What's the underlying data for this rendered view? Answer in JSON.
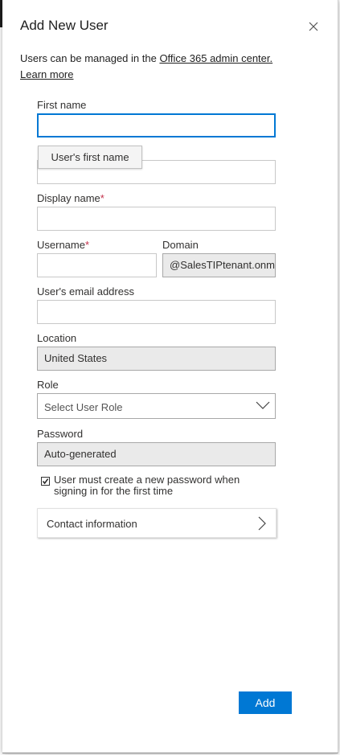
{
  "panel": {
    "title": "Add New User",
    "intro_text": "Users can be managed in the ",
    "admin_link": "Office 365 admin center.",
    "learn_more": "Learn more"
  },
  "form": {
    "first_name_label": "First name",
    "first_name_value": "",
    "first_name_tooltip": "User's first name",
    "last_name_value": "",
    "display_name_label": "Display name",
    "display_name_value": "",
    "required_mark": "*",
    "username_label": "Username",
    "username_value": "",
    "domain_label": "Domain",
    "domain_value": "@SalesTIPtenant.onmicrosoft.com",
    "email_label": "User's email address",
    "email_value": "",
    "location_label": "Location",
    "location_value": "United States",
    "role_label": "Role",
    "role_value": "Select User Role",
    "password_label": "Password",
    "password_value": "Auto-generated",
    "change_password_label": "User must create a new password when signing in for the first time",
    "change_password_checked": true,
    "contact_info_label": "Contact information"
  },
  "actions": {
    "add_label": "Add"
  },
  "colors": {
    "accent": "#0078d4",
    "required": "#c4314b"
  },
  "icons": {
    "close": "close-icon",
    "role_dropdown": "chevron-down-icon",
    "contact_expand": "chevron-right-icon",
    "checkbox": "checkmark-icon"
  }
}
